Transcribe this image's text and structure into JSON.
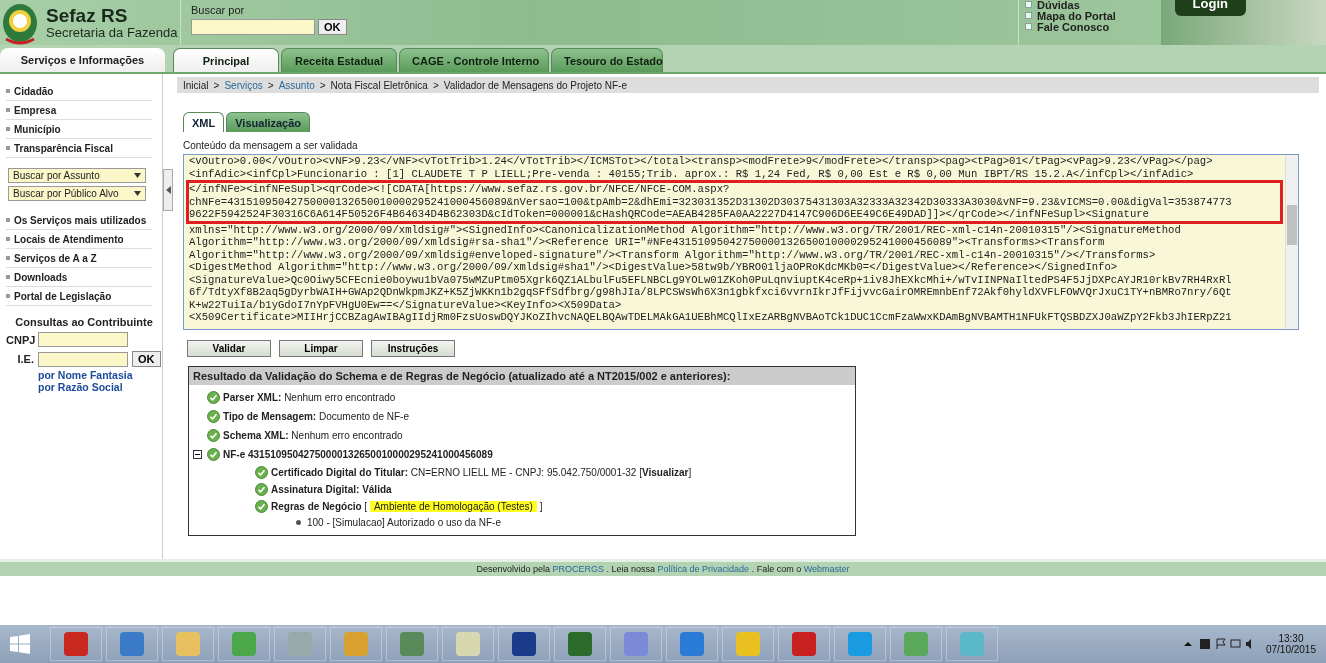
{
  "header": {
    "title": "Sefaz RS",
    "subtitle": "Secretaria da Fazenda",
    "search": {
      "label": "Buscar por",
      "button": "OK"
    },
    "links": [
      "Dúvidas",
      "Mapa do Portal",
      "Fale Conosco"
    ],
    "login": "Login"
  },
  "sidebar": {
    "heading": "Serviços e Informações",
    "items": [
      "Cidadão",
      "Empresa",
      "Município",
      "Transparência Fiscal"
    ],
    "selects": [
      "Buscar por Assunto",
      "Buscar por Público Alvo"
    ],
    "items2": [
      "Os Serviços mais utilizados",
      "Locais de Atendimento",
      "Serviços de A a Z",
      "Downloads",
      "Portal de Legislação"
    ],
    "consult": {
      "title": "Consultas ao Contribuinte",
      "fields": [
        {
          "label": "CNPJ"
        },
        {
          "label": "I.E."
        }
      ],
      "button": "OK",
      "links": [
        "por Nome Fantasia",
        "por Razão Social"
      ]
    }
  },
  "tabs": [
    {
      "label": "Principal",
      "selected": true
    },
    {
      "label": "Receita Estadual",
      "selected": false
    },
    {
      "label": "CAGE - Controle Interno",
      "selected": false
    },
    {
      "label": "Tesouro do Estado",
      "selected": false
    }
  ],
  "breadcrumb_separator": ">",
  "breadcrumb": [
    {
      "label": "Inicial",
      "link": false
    },
    {
      "label": "Serviços",
      "link": true
    },
    {
      "label": "Assunto",
      "link": true
    },
    {
      "label": "Nota Fiscal Eletrônica",
      "link": false
    },
    {
      "label": "Validador de Mensagens do Projeto NF-e",
      "link": false
    }
  ],
  "subtabs": [
    {
      "label": "XML",
      "selected": true
    },
    {
      "label": "Visualização",
      "selected": false
    }
  ],
  "editor": {
    "label": "Conteúdo da mensagem a ser validada",
    "lines": [
      {
        "text": "<vOutro>0.00</vOutro><vNF>9.23</vNF><vTotTrib>1.24</vTotTrib></ICMSTot></total><transp><modFrete>9</modFrete></transp><pag><tPag>01</tPag><vPag>9.23</vPag></pag>",
        "highlighted": false
      },
      {
        "text": "<infAdic><infCpl>Funcionario : [1] CLAUDETE T P LIELL;Pre-venda : 40155;Trib. aprox.: R$ 1,24 Fed, R$ 0,00 Est e R$ 0,00 Mun IBPT/RS 15.2.A</infCpl></infAdic>",
        "highlighted": false
      },
      {
        "text": "</infNFe><infNFeSupl><qrCode><![CDATA[https://www.sefaz.rs.gov.br/NFCE/NFCE-COM.aspx?",
        "highlighted": true
      },
      {
        "text": "chNFe=43151095042750000132650010000295241000456089&nVersao=100&tpAmb=2&dhEmi=323031352D31302D30375431303A32333A32342D30333A3030&vNF=9.23&vICMS=0.00&digVal=353874773",
        "highlighted": true
      },
      {
        "text": "9622F5942524F30316C6A614F50526F4B64634D4B62303D&cIdToken=000001&cHashQRCode=AEAB4285FA0AA2227D4147C906D6EE49C6E49DAD]]></qrCode></infNFeSupl><Signature",
        "highlighted": true
      },
      {
        "text": "xmlns=\"http://www.w3.org/2000/09/xmldsig#\"><SignedInfo><CanonicalizationMethod Algorithm=\"http://www.w3.org/TR/2001/REC-xml-c14n-20010315\"/><SignatureMethod",
        "highlighted": false
      },
      {
        "text": "Algorithm=\"http://www.w3.org/2000/09/xmldsig#rsa-sha1\"/><Reference URI=\"#NFe43151095042750000132650010000295241000456089\"><Transforms><Transform",
        "highlighted": false
      },
      {
        "text": "Algorithm=\"http://www.w3.org/2000/09/xmldsig#enveloped-signature\"/><Transform Algorithm=\"http://www.w3.org/TR/2001/REC-xml-c14n-20010315\"/></Transforms>",
        "highlighted": false
      },
      {
        "text": "<DigestMethod Algorithm=\"http://www.w3.org/2000/09/xmldsig#sha1\"/><DigestValue>58tw9b/YBRO01ljaOPRoKdcMKb0=</DigestValue></Reference></SignedInfo>",
        "highlighted": false
      },
      {
        "text": "<SignatureValue>Qc0Oiwy5CFEcnie0boywu1bVa075wMZuPtm05Xgrk6QZ1ALbulFu5EFLNBCLg9YOLw01ZKoh0PuLqnviuptK4ceRp+1iv8JhEXkcMhi+/wTvIINPNaIltedPS4F5JjDXPcAYJR10rkBv7RH4RxRl",
        "highlighted": false
      },
      {
        "text": "6f/TdtyXf8B2aq5gDyrbWAIH+GWAp2QDnWkpmJKZ+K5ZjWKKn1b2gqSFfSdfbrg/g98hJIa/8LPCSWsWh6X3n1gbkfxci6vvrnIkrJfFijvvcGairOMREmnbEnf72Akf0hyldXVFLFOWVQrJxuC1TY+nBMRo7nry/6Qt",
        "highlighted": false
      },
      {
        "text": "K+w22TuiIa/b1yGdoI7nYpFVHgU0Ew==</SignatureValue><KeyInfo><X509Data>",
        "highlighted": false
      },
      {
        "text": "<X509Certificate>MIIHrjCCBZagAwIBAgIIdjRm0FzsUoswDQYJKoZIhvcNAQELBQAwTDELMAkGA1UEBhMCQlIxEzARBgNVBAoTCk1DUC1CcmFzaWwxKDAmBgNVBAMTH1NFUkFTQSBDZXJ0aWZpY2Fkb3JhIERpZ21",
        "highlighted": false
      }
    ]
  },
  "buttons": [
    "Validar",
    "Limpar",
    "Instruções"
  ],
  "results": {
    "title": "Resultado da Validação do Schema e de Regras de Negócio (atualizado até a NT2015/002 e anteriores):",
    "items": [
      {
        "kind": "check",
        "label": "Parser XML:",
        "value": "Nenhum erro encontrado"
      },
      {
        "kind": "check",
        "label": "Tipo de Mensagem:",
        "value": "Documento de NF-e"
      },
      {
        "kind": "check",
        "label": "Schema XML:",
        "value": "Nenhum erro encontrado"
      },
      {
        "kind": "check",
        "label": "NF-e 43151095042750000132650010000295241000456089",
        "expanded": true,
        "children": [
          {
            "kind": "check",
            "label": "Certificado Digital do Titular:",
            "value": "CN=ERNO LIELL ME - CNPJ: 95.042.750/0001-32 [**Visualizar**]"
          },
          {
            "kind": "check",
            "label": "Assinatura Digital:",
            "value": "**Válida**"
          },
          {
            "kind": "badge",
            "label": "Regras de Negócio",
            "before": "[",
            "badge": "Ambiente de Homologação (Testes)",
            "after": "]",
            "children": [
              {
                "kind": "bullet",
                "value": "100 - [Simulacao] Autorizado o uso da NF-e"
              }
            ]
          }
        ]
      }
    ]
  },
  "footer": [
    {
      "kind": "text",
      "text": "Desenvolvido pela"
    },
    {
      "kind": "link",
      "text": "PROCERGS"
    },
    {
      "kind": "text",
      "text": ". Leia nossa"
    },
    {
      "kind": "link",
      "text": "Política de Privacidade"
    },
    {
      "kind": "text",
      "text": ". Fale com o"
    },
    {
      "kind": "link",
      "text": "Webmaster"
    }
  ],
  "taskbar": {
    "time": "13:30",
    "date": "07/10/2015"
  }
}
